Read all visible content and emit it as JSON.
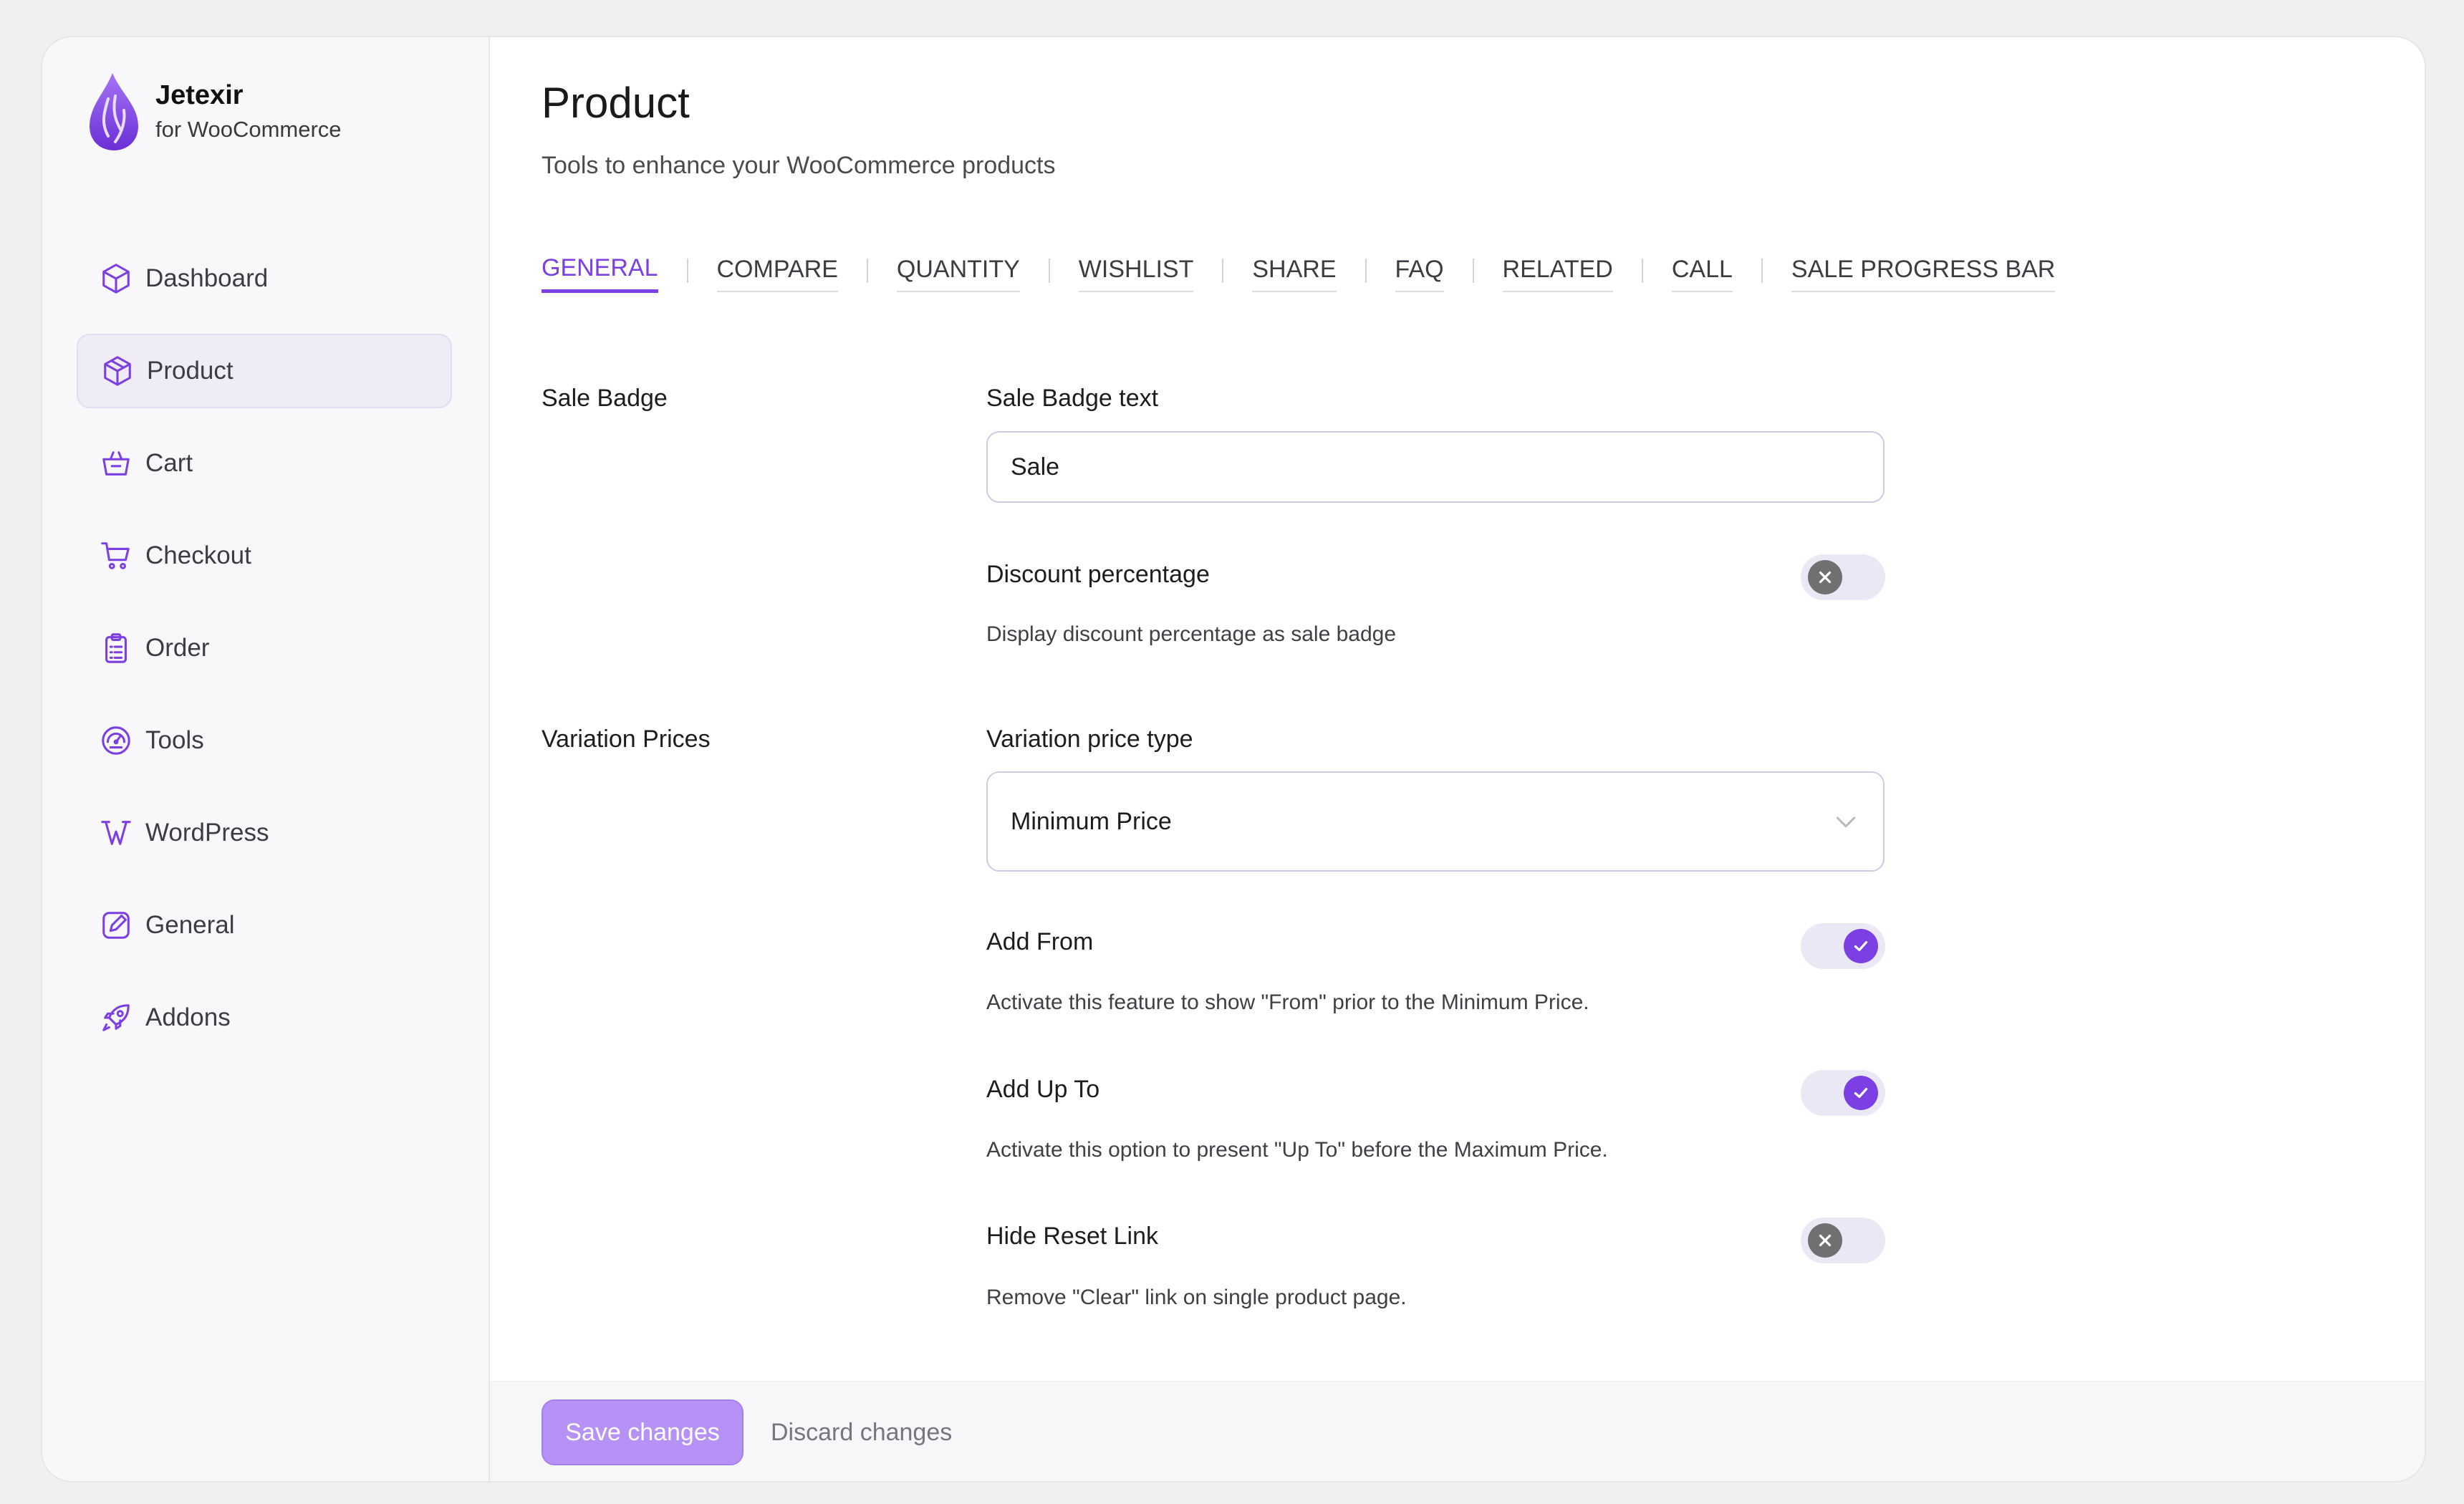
{
  "brand": {
    "name": "Jetexir",
    "subtitle": "for WooCommerce",
    "logo_icon": "flame-drop-logo"
  },
  "sidebar": {
    "items": [
      {
        "label": "Dashboard",
        "icon": "cube-icon",
        "active": false
      },
      {
        "label": "Product",
        "icon": "box-icon",
        "active": true
      },
      {
        "label": "Cart",
        "icon": "basket-icon",
        "active": false
      },
      {
        "label": "Checkout",
        "icon": "cart-icon",
        "active": false
      },
      {
        "label": "Order",
        "icon": "clipboard-icon",
        "active": false
      },
      {
        "label": "Tools",
        "icon": "gauge-icon",
        "active": false
      },
      {
        "label": "WordPress",
        "icon": "wordpress-icon",
        "active": false
      },
      {
        "label": "General",
        "icon": "edit-icon",
        "active": false
      },
      {
        "label": "Addons",
        "icon": "rocket-icon",
        "active": false
      }
    ]
  },
  "page": {
    "title": "Product",
    "subtitle": "Tools to enhance your WooCommerce products"
  },
  "tabs": [
    "GENERAL",
    "COMPARE",
    "QUANTITY",
    "WISHLIST",
    "SHARE",
    "FAQ",
    "RELATED",
    "CALL",
    "SALE PROGRESS BAR"
  ],
  "active_tab": "GENERAL",
  "sale_badge": {
    "section_label": "Sale Badge",
    "text_label": "Sale Badge text",
    "text_value": "Sale",
    "discount_label": "Discount percentage",
    "discount_desc": "Display discount percentage as sale badge",
    "discount_enabled": false
  },
  "variation_prices": {
    "section_label": "Variation Prices",
    "type_label": "Variation price type",
    "type_value": "Minimum Price",
    "add_from_label": "Add From",
    "add_from_desc": "Activate this feature to show \"From\" prior to the Minimum Price.",
    "add_from_enabled": true,
    "add_up_to_label": "Add Up To",
    "add_up_to_desc": "Activate this option to present \"Up To\" before the Maximum Price.",
    "add_up_to_enabled": true,
    "hide_reset_label": "Hide Reset Link",
    "hide_reset_desc": "Remove \"Clear\" link on single product page.",
    "hide_reset_enabled": false
  },
  "footer": {
    "save_label": "Save changes",
    "discard_label": "Discard changes"
  },
  "colors": {
    "accent": "#7b3fe4",
    "save_button": "#b692f6",
    "toggle_off_knob": "#707070"
  }
}
